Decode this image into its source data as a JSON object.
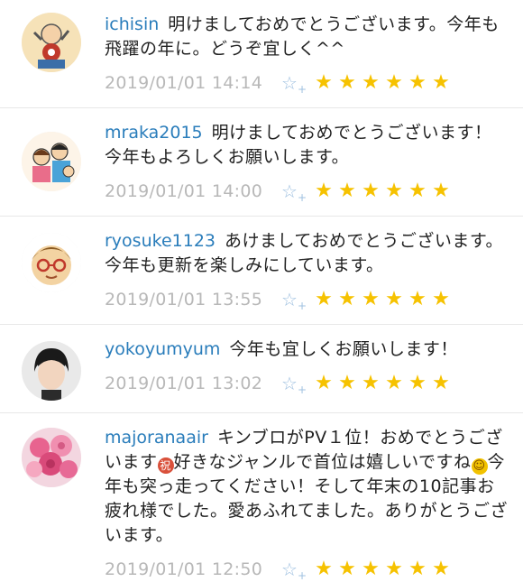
{
  "comments": [
    {
      "user": "ichisin",
      "text": "明けましておめでとうございます。今年も飛躍の年に。どうぞ宜しく^^",
      "date": "2019/01/01 14:14",
      "stars": 6
    },
    {
      "user": "mraka2015",
      "text": "明けましておめでとうございます！今年もよろしくお願いします。",
      "date": "2019/01/01 14:00",
      "stars": 6
    },
    {
      "user": "ryosuke1123",
      "text": "あけましておめでとうございます。今年も更新を楽しみにしています。",
      "date": "2019/01/01 13:55",
      "stars": 6
    },
    {
      "user": "yokoyumyum",
      "text": "今年も宜しくお願いします！",
      "date": "2019/01/01 13:02",
      "stars": 6
    },
    {
      "user": "majoranaair",
      "text_a": "キンブロがPV１位！おめでとうございます",
      "emoji_a": "祝",
      "text_b": "好きなジャンルで首位は嬉しいですね",
      "emoji_b": "☺",
      "text_c": "今年も突っ走ってください！そして年末の10記事お疲れ様でした。愛あふれてました。ありがとうございます。",
      "date": "2019/01/01 12:50",
      "stars": 6
    }
  ],
  "icons": {
    "avatar": "user-avatar-icon",
    "add_star": "add-star-icon",
    "star": "star-icon"
  },
  "colors": {
    "username": "#2a7dbb",
    "date": "#b8b8b8",
    "star": "#f6c200",
    "add_star": "#9fc0e0"
  },
  "star_glyph": "★",
  "add_star_glyph": "☆",
  "add_star_plus": "+"
}
